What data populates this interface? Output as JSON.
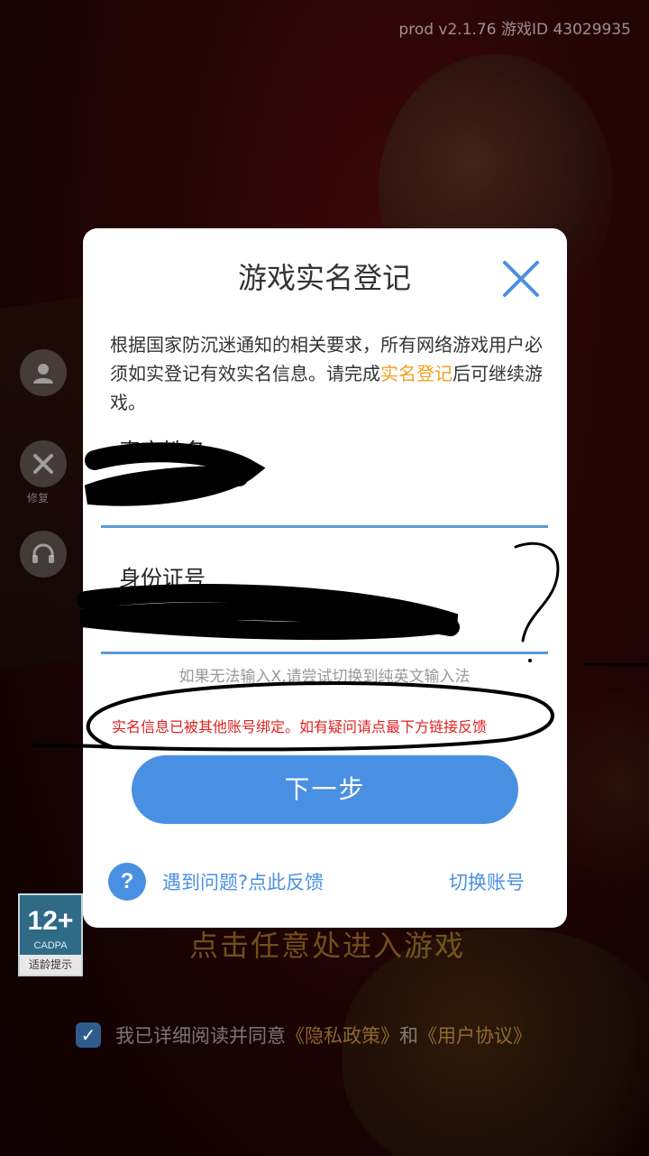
{
  "header": {
    "version_text": "prod v2.1.76 游戏ID 43029935"
  },
  "background": {
    "side_buttons": [
      {
        "icon": "user-icon",
        "label": ""
      },
      {
        "icon": "wrench-icon",
        "label": "修复"
      },
      {
        "icon": "headset-icon",
        "label": ""
      }
    ],
    "age_rating": {
      "age": "12+",
      "org": "CADPA",
      "tip": "适龄提示"
    },
    "enter_game_text": "点击任意处进入游戏",
    "agreement": {
      "checked": true,
      "prefix": "我已详细阅读并同意",
      "privacy_link": "《隐私政策》",
      "and_text": "和",
      "user_agreement_link": "《用户协议》"
    }
  },
  "modal": {
    "title": "游戏实名登记",
    "notice_part1": "根据国家防沉迷通知的相关要求，所有网络游戏用户必须如实登记有效实名信息。请完成",
    "notice_highlight": "实名登记",
    "notice_part2": "后可继续游戏。",
    "name_label": "真实姓名",
    "name_value": "",
    "id_label": "身份证号",
    "id_value": "",
    "input_hint": "如果无法输入X,请尝试切换到纯英文输入法",
    "error_message": "实名信息已被其他账号绑定。如有疑问请点最下方链接反馈",
    "next_button": "下一步",
    "help_icon_text": "?",
    "help_link": "遇到问题?点此反馈",
    "switch_account": "切换账号"
  },
  "colors": {
    "accent": "#4a90e2",
    "highlight": "#f0a020",
    "error": "#e02020",
    "underline": "#5a9bd8"
  }
}
